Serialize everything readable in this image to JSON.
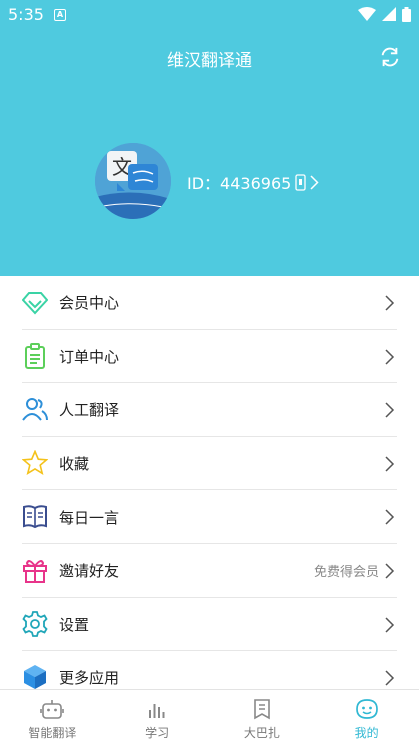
{
  "status": {
    "time": "5:35",
    "app_badge": "A"
  },
  "header": {
    "title": "维汉翻译通",
    "user_id": "ID：4436965"
  },
  "menu": [
    {
      "label": "会员中心",
      "icon": "diamond-icon",
      "extra": ""
    },
    {
      "label": "订单中心",
      "icon": "clipboard-icon",
      "extra": ""
    },
    {
      "label": "人工翻译",
      "icon": "people-icon",
      "extra": ""
    },
    {
      "label": "收藏",
      "icon": "star-icon",
      "extra": ""
    },
    {
      "label": "每日一言",
      "icon": "book-icon",
      "extra": ""
    },
    {
      "label": "邀请好友",
      "icon": "gift-icon",
      "extra": "免费得会员"
    },
    {
      "label": "设置",
      "icon": "gear-icon",
      "extra": ""
    },
    {
      "label": "更多应用",
      "icon": "cube-icon",
      "extra": ""
    }
  ],
  "tabs": [
    {
      "label": "智能翻译",
      "icon": "robot-icon",
      "active": false
    },
    {
      "label": "学习",
      "icon": "bars-icon",
      "active": false
    },
    {
      "label": "大巴扎",
      "icon": "note-icon",
      "active": false
    },
    {
      "label": "我的",
      "icon": "face-icon",
      "active": true
    }
  ],
  "colors": {
    "header": "#4fcadf",
    "accent": "#30b8d3",
    "diamond": "#3ad3a5",
    "clipboard": "#5ccf5a",
    "people": "#2d8fd8",
    "star": "#f4c21b",
    "book": "#3a4d8f",
    "gift": "#e8348a",
    "gear": "#20a6b8",
    "cube": "#2b8fe3"
  }
}
